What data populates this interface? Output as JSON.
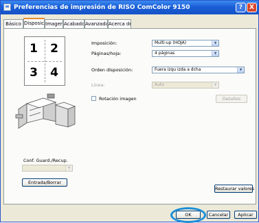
{
  "window": {
    "title": "Preferencias de impresión de RISO ComColor 9150"
  },
  "title_buttons": {
    "help": "?",
    "close": "X"
  },
  "tabs": [
    "Básico",
    "Disposic.",
    "Imagen",
    "Acabado",
    "Avanzada",
    "Acerca de"
  ],
  "active_tab": "Disposic.",
  "preview": {
    "pages": [
      "1",
      "2",
      "3",
      "4"
    ]
  },
  "layout": {
    "label": "Imposición:",
    "value": "Multi-up (HOJA)"
  },
  "pages_per_sheet": {
    "label": "Páginas/hoja:",
    "value": "4 páginas"
  },
  "order": {
    "label": "Orden disposición:",
    "value": "Fuera izqu izda a dcha"
  },
  "frame": {
    "label": "Línea:",
    "value": "Auto"
  },
  "rotate_image": {
    "label": "Rotación imagen",
    "checked": false
  },
  "detail_button": "Detalles",
  "config": {
    "label": "Conf. Guard./Recup.",
    "select_value": "",
    "button": "Entrada/Borrar"
  },
  "restore_button": "Restaurar valores",
  "footer": {
    "ok": "OK",
    "cancel": "Cancelar",
    "apply": "Aplicar"
  },
  "colors": {
    "highlight_ring": "#1c8ed8",
    "title_bar": "#1a5fd6"
  }
}
